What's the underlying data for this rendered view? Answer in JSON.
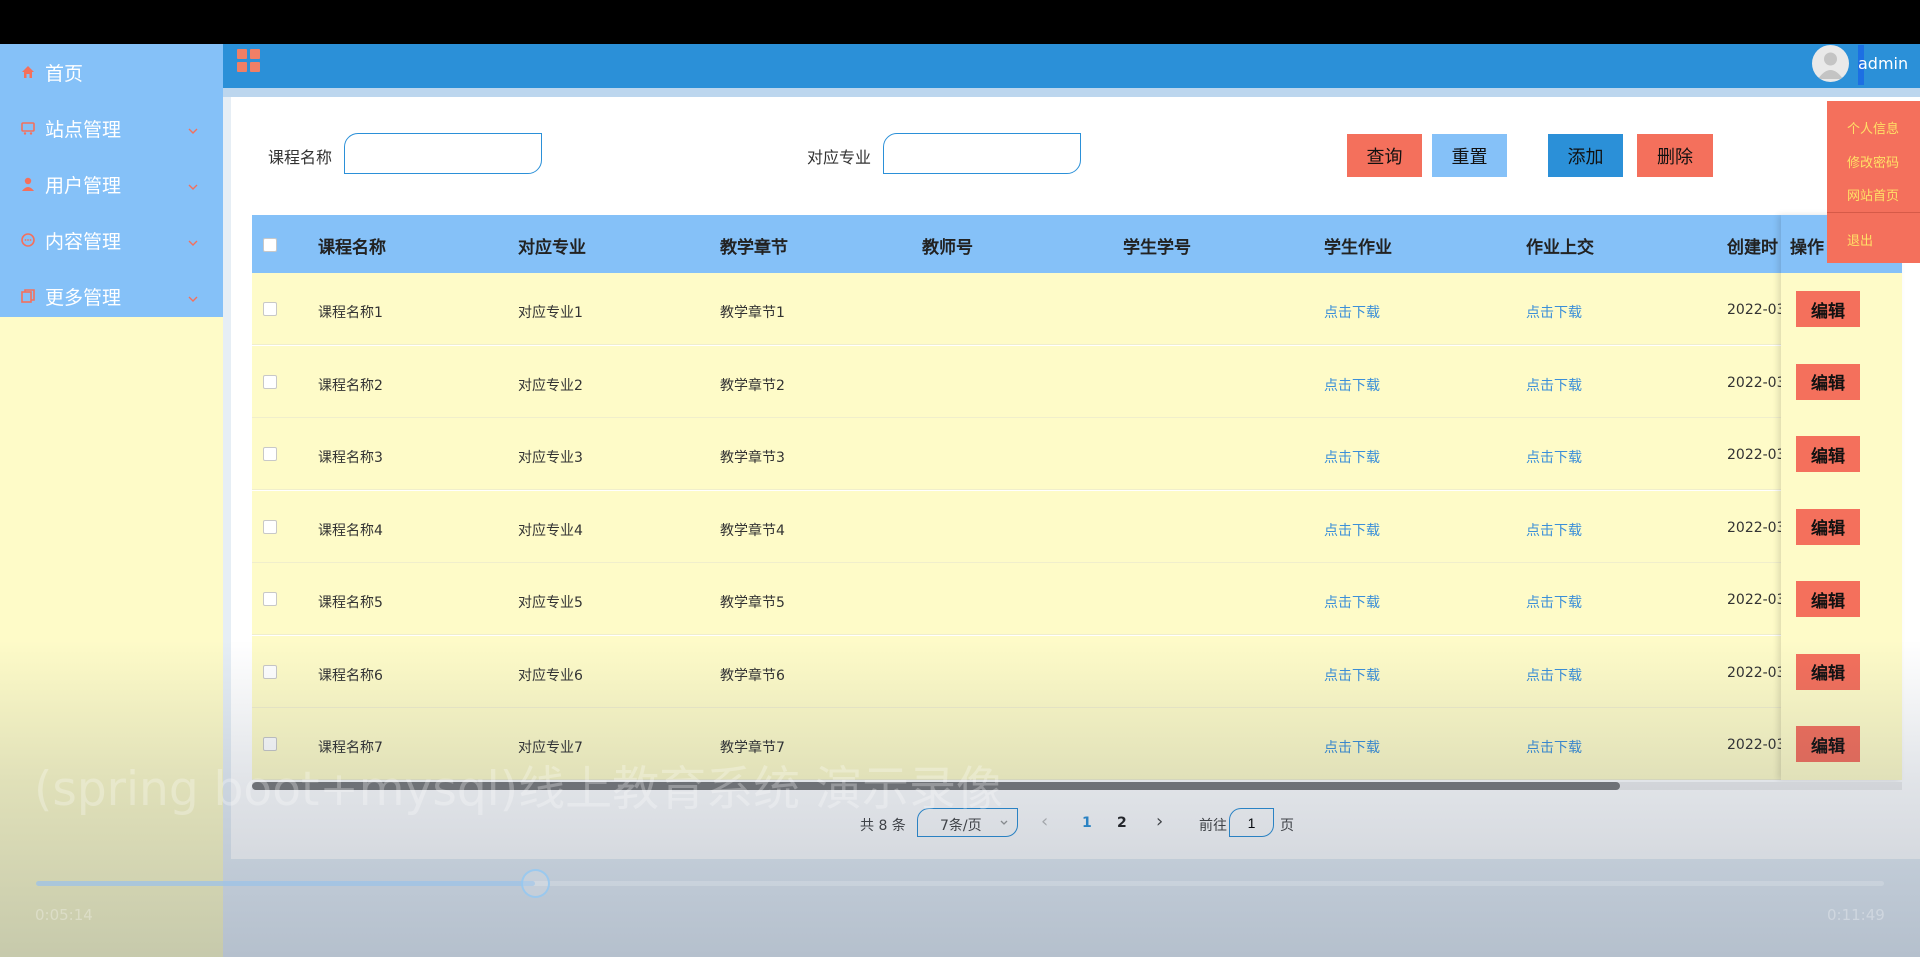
{
  "sidebar": {
    "items": [
      {
        "label": "首页",
        "icon": "home-icon"
      },
      {
        "label": "站点管理",
        "icon": "cart-icon"
      },
      {
        "label": "用户管理",
        "icon": "user-icon"
      },
      {
        "label": "内容管理",
        "icon": "chat-icon"
      },
      {
        "label": "更多管理",
        "icon": "copy-icon"
      }
    ]
  },
  "header": {
    "username": "admin"
  },
  "search": {
    "course_label": "课程名称",
    "major_label": "对应专业"
  },
  "toolbar": {
    "query_label": "查询",
    "reset_label": "重置",
    "add_label": "添加",
    "delete_label": "删除"
  },
  "table": {
    "headers": [
      "课程名称",
      "对应专业",
      "教学章节",
      "教师号",
      "学生学号",
      "学生作业",
      "作业上交",
      "创建时",
      "操作"
    ],
    "rows": [
      {
        "course": "课程名称1",
        "major": "对应专业1",
        "chapter": "教学章节1",
        "homework": "点击下载",
        "submit": "点击下载",
        "created": "2022-03-",
        "edit": "编辑"
      },
      {
        "course": "课程名称2",
        "major": "对应专业2",
        "chapter": "教学章节2",
        "homework": "点击下载",
        "submit": "点击下载",
        "created": "2022-03-",
        "edit": "编辑"
      },
      {
        "course": "课程名称3",
        "major": "对应专业3",
        "chapter": "教学章节3",
        "homework": "点击下载",
        "submit": "点击下载",
        "created": "2022-03-",
        "edit": "编辑"
      },
      {
        "course": "课程名称4",
        "major": "对应专业4",
        "chapter": "教学章节4",
        "homework": "点击下载",
        "submit": "点击下载",
        "created": "2022-03-",
        "edit": "编辑"
      },
      {
        "course": "课程名称5",
        "major": "对应专业5",
        "chapter": "教学章节5",
        "homework": "点击下载",
        "submit": "点击下载",
        "created": "2022-03-",
        "edit": "编辑"
      },
      {
        "course": "课程名称6",
        "major": "对应专业6",
        "chapter": "教学章节6",
        "homework": "点击下载",
        "submit": "点击下载",
        "created": "2022-03-",
        "edit": "编辑"
      },
      {
        "course": "课程名称7",
        "major": "对应专业7",
        "chapter": "教学章节7",
        "homework": "点击下载",
        "submit": "点击下载",
        "created": "2022-03-",
        "edit": "编辑"
      }
    ]
  },
  "pagination": {
    "total": "共 8 条",
    "page_size": "7条/页",
    "prev": "‹",
    "page1": "1",
    "page2": "2",
    "next": "›",
    "goto_prefix": "前往",
    "goto_value": "1",
    "goto_suffix": "页"
  },
  "dropdown": {
    "items": [
      "个人信息",
      "修改密码",
      "网站首页",
      "退出"
    ]
  },
  "video": {
    "caption": "(spring boot+mysql)线上教育系统 演示录像",
    "current_time": "0:05:14",
    "total_time": "0:11:49",
    "progress": 0.2698
  },
  "colors": {
    "primary": "#2b90d8",
    "light_blue": "#85c1f8",
    "accent_red": "#f4705c",
    "row_yellow": "#fefbc8",
    "link_blue": "#3b8fd9"
  }
}
